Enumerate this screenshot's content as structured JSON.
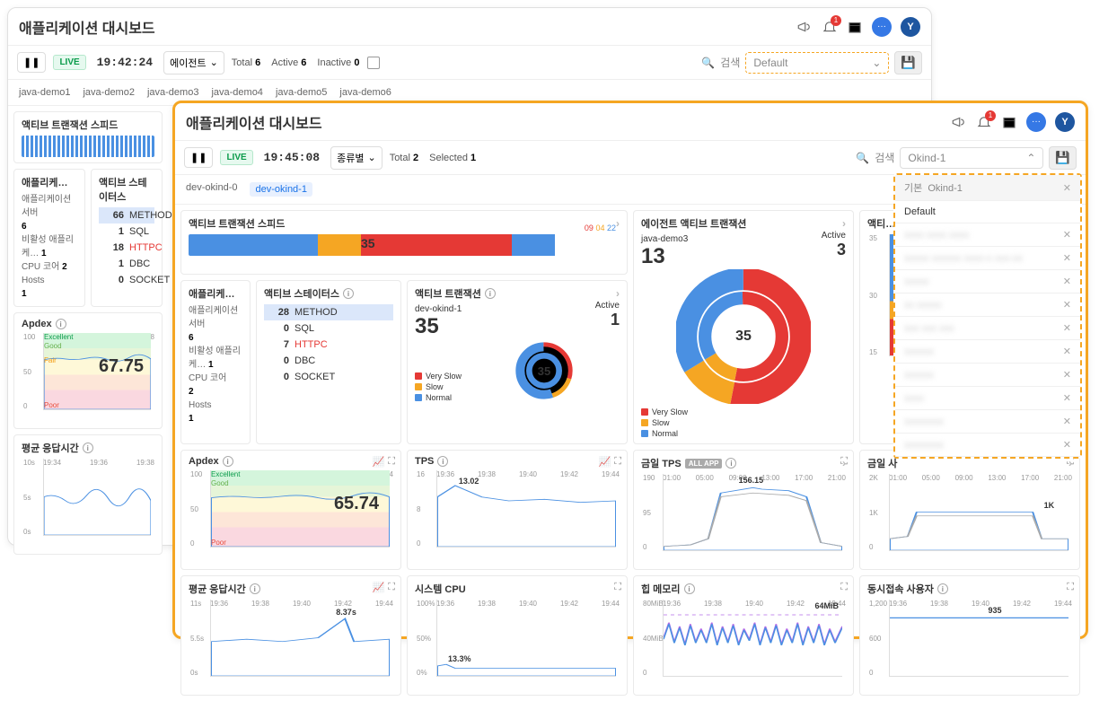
{
  "back": {
    "title": "애플리케이션 대시보드",
    "badge": "1",
    "avatar": "Y",
    "live": "LIVE",
    "clock": "19:42:24",
    "agent_btn": "에이전트",
    "stats": {
      "total_l": "Total",
      "total_v": "6",
      "active_l": "Active",
      "active_v": "6",
      "inactive_l": "Inactive",
      "inactive_v": "0"
    },
    "search_l": "검색",
    "dd": "Default",
    "tabs": [
      "java-demo1",
      "java-demo2",
      "java-demo3",
      "java-demo4",
      "java-demo5",
      "java-demo6"
    ],
    "speed_title": "액티브 트랜잭션 스피드",
    "app_title": "애플리케…",
    "app_kv": [
      [
        "애플리케이션 서버",
        "6"
      ],
      [
        "비활성 애플리케…",
        "1"
      ],
      [
        "CPU 코어",
        "2"
      ],
      [
        "Hosts",
        "1"
      ]
    ],
    "status_title": "액티브 스테이터스",
    "status_rows": [
      [
        "66",
        "METHOD"
      ],
      [
        "1",
        "SQL"
      ],
      [
        "18",
        "HTTPC"
      ],
      [
        "1",
        "DBC"
      ],
      [
        "0",
        "SOCKET"
      ]
    ],
    "apdex_title": "Apdex",
    "apdex_val": "67.75",
    "apdex_y": [
      "100",
      "50",
      "0"
    ],
    "apdex_x": [
      "19:34",
      "19:36",
      "19:38"
    ],
    "apdex_bands": {
      "ex": "Excellent",
      "gd": "Good",
      "fa": "Fair",
      "po": "Poor"
    },
    "resp_title": "평균 응답시간",
    "resp_y": [
      "10s",
      "5s",
      "0s"
    ],
    "resp_x": [
      "19:34",
      "19:36",
      "19:38"
    ]
  },
  "front": {
    "title": "애플리케이션 대시보드",
    "badge": "1",
    "avatar": "Y",
    "live": "LIVE",
    "clock": "19:45:08",
    "kind_btn": "종류별",
    "stats": {
      "total_l": "Total",
      "total_v": "2",
      "sel_l": "Selected",
      "sel_v": "1"
    },
    "search_l": "검색",
    "dd": "Okind-1",
    "tabs": [
      "dev-okind-0",
      "dev-okind-1"
    ],
    "speed_title": "액티브 트랜잭션 스피드",
    "speed_num": "35",
    "speed_tally": [
      "09",
      "04",
      "22"
    ],
    "agent_act_title": "에이전트 액티브 트랜잭션",
    "agent_act_sub": "java-demo3",
    "agent_act_big": "13",
    "agent_act_rl": "Active",
    "agent_act_rv": "3",
    "agent_act_donut": "35",
    "legend": [
      [
        "r",
        "Very Slow"
      ],
      [
        "o",
        "Slow"
      ],
      [
        "b",
        "Normal"
      ]
    ],
    "mini_act_title": "액티…",
    "mini_act_y": [
      "35",
      "30",
      "15"
    ],
    "app_title": "애플리케…",
    "app_kv": [
      [
        "애플리케이션 서버",
        "6"
      ],
      [
        "비활성 애플리케…",
        "1"
      ],
      [
        "CPU 코어",
        "2"
      ],
      [
        "Hosts",
        "1"
      ]
    ],
    "status_title": "액티브 스테이터스",
    "status_rows": [
      [
        "28",
        "METHOD"
      ],
      [
        "0",
        "SQL"
      ],
      [
        "7",
        "HTTPC"
      ],
      [
        "0",
        "DBC"
      ],
      [
        "0",
        "SOCKET"
      ]
    ],
    "activetx_title": "액티브 트랜잭션",
    "activetx_sub": "dev-okind-1",
    "activetx_big": "35",
    "activetx_rl": "Active",
    "activetx_rv": "1",
    "activetx_donut": "35",
    "apdex_title": "Apdex",
    "apdex_val": "65.74",
    "apdex_y": [
      "100",
      "50",
      "0"
    ],
    "tps_title": "TPS",
    "tps_val": "13.02",
    "tps_y": [
      "16",
      "8",
      "0"
    ],
    "dtps_title": "금일 TPS",
    "dtps_all": "ALL APP",
    "dtps_val": "156.15",
    "dtps_y": [
      "190",
      "95",
      "0"
    ],
    "dtps_x": [
      "01:00",
      "05:00",
      "09:00",
      "13:00",
      "17:00",
      "21:00"
    ],
    "dusr_title": "금일 사",
    "dusr_val": "1K",
    "dusr_y": [
      "2K",
      "1K",
      "0"
    ],
    "x_time": [
      "19:36",
      "19:38",
      "19:40",
      "19:42",
      "19:44"
    ],
    "resp_title": "평균 응답시간",
    "resp_val": "8.37s",
    "resp_y": [
      "11s",
      "5.5s",
      "0s"
    ],
    "cpu_title": "시스템 CPU",
    "cpu_val": "13.3%",
    "cpu_y": [
      "100%",
      "50%",
      "0%"
    ],
    "heap_title": "힙 메모리",
    "heap_val": "64MiB",
    "heap_y": [
      "80MiB",
      "40MiB",
      "0"
    ],
    "conc_title": "동시접속 사용자",
    "conc_val": "935",
    "conc_y": [
      "1,200",
      "600",
      "0"
    ],
    "dropdown": {
      "hd_l": "기본",
      "hd_v": "Okind-1",
      "rows": [
        "Default",
        "xxxx xxxx xxxx",
        "xxxxx xxxxxx xxxx-x xxx-xx",
        "xxxxx",
        "xx xxxxx",
        "xxx xxx xxx",
        "xxxxxx",
        "xxxxxx",
        "xxxx",
        "xxxxxxxx",
        "xxxxxxxx"
      ]
    }
  },
  "chart_data": [
    {
      "type": "line",
      "title": "Apdex (back)",
      "ylim": [
        0,
        100
      ],
      "x": [
        "19:34",
        "19:36",
        "19:38"
      ],
      "values": [
        68,
        67,
        68
      ],
      "annotation": 67.75
    },
    {
      "type": "line",
      "title": "평균 응답시간 (back)",
      "ylim": [
        0,
        10
      ],
      "x": [
        "19:34",
        "19:36",
        "19:38"
      ],
      "values": [
        5,
        5.5,
        5
      ]
    },
    {
      "type": "line",
      "title": "Apdex (front)",
      "ylim": [
        0,
        100
      ],
      "x": [
        "19:36",
        "19:38",
        "19:40",
        "19:42",
        "19:44"
      ],
      "values": [
        66,
        65,
        66,
        65,
        66
      ],
      "annotation": 65.74
    },
    {
      "type": "line",
      "title": "TPS",
      "ylim": [
        0,
        16
      ],
      "x": [
        "19:36",
        "19:38",
        "19:40",
        "19:42",
        "19:44"
      ],
      "values": [
        13,
        11,
        10,
        10,
        10
      ],
      "annotation": 13.02
    },
    {
      "type": "area",
      "title": "금일 TPS",
      "ylim": [
        0,
        190
      ],
      "x": [
        "01:00",
        "05:00",
        "09:00",
        "13:00",
        "17:00",
        "21:00"
      ],
      "values": [
        10,
        15,
        150,
        156,
        150,
        30
      ],
      "annotation": 156.15
    },
    {
      "type": "area",
      "title": "금일 사용자",
      "ylim": [
        0,
        2000
      ],
      "x": [
        "01:00",
        "05:00",
        "09:00",
        "13:00",
        "17:00",
        "21:00"
      ],
      "values": [
        200,
        200,
        1000,
        1000,
        1000,
        300
      ],
      "annotation": 1000
    },
    {
      "type": "line",
      "title": "평균 응답시간 (front)",
      "ylim": [
        0,
        11
      ],
      "x": [
        "19:36",
        "19:38",
        "19:40",
        "19:42",
        "19:44"
      ],
      "values": [
        5,
        5,
        5.5,
        8.37,
        5
      ],
      "annotation": 8.37
    },
    {
      "type": "line",
      "title": "시스템 CPU",
      "ylim": [
        0,
        100
      ],
      "x": [
        "19:36",
        "19:38",
        "19:40",
        "19:42",
        "19:44"
      ],
      "values": [
        13,
        12,
        12,
        12,
        12
      ],
      "annotation": 13.3
    },
    {
      "type": "line",
      "title": "힙 메모리",
      "ylim": [
        0,
        80
      ],
      "x": [
        "19:36",
        "19:38",
        "19:40",
        "19:42",
        "19:44"
      ],
      "values": [
        50,
        40,
        55,
        45,
        64
      ],
      "annotation": 64
    },
    {
      "type": "line",
      "title": "동시접속 사용자",
      "ylim": [
        0,
        1200
      ],
      "x": [
        "19:36",
        "19:38",
        "19:40",
        "19:42",
        "19:44"
      ],
      "values": [
        935,
        930,
        930,
        930,
        930
      ],
      "annotation": 935
    },
    {
      "type": "pie",
      "title": "액티브 트랜잭션",
      "total": 35,
      "series": [
        {
          "name": "Very Slow",
          "value": 10
        },
        {
          "name": "Slow",
          "value": 5
        },
        {
          "name": "Normal",
          "value": 20
        }
      ]
    },
    {
      "type": "pie",
      "title": "에이전트 액티브 트랜잭션",
      "total": 35,
      "series": [
        {
          "name": "Very Slow",
          "value": 18
        },
        {
          "name": "Slow",
          "value": 5
        },
        {
          "name": "Normal",
          "value": 12
        }
      ]
    }
  ]
}
